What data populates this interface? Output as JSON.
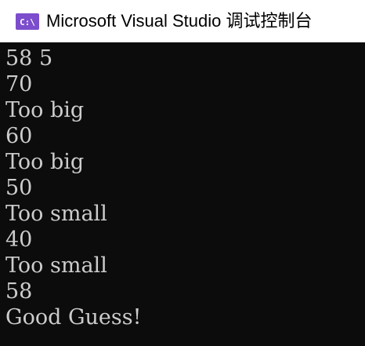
{
  "window": {
    "title": "Microsoft Visual Studio 调试控制台",
    "icon": "visual-studio-console-icon",
    "icon_color": "#7c4dcc",
    "titlebar_color": "#ffffff"
  },
  "console": {
    "background": "#0c0c0c",
    "text_color": "#cccccc",
    "lines": [
      "58 5",
      "70",
      "Too big",
      "60",
      "Too big",
      "50",
      "Too small",
      "40",
      "Too small",
      "58",
      "Good Guess!"
    ]
  }
}
